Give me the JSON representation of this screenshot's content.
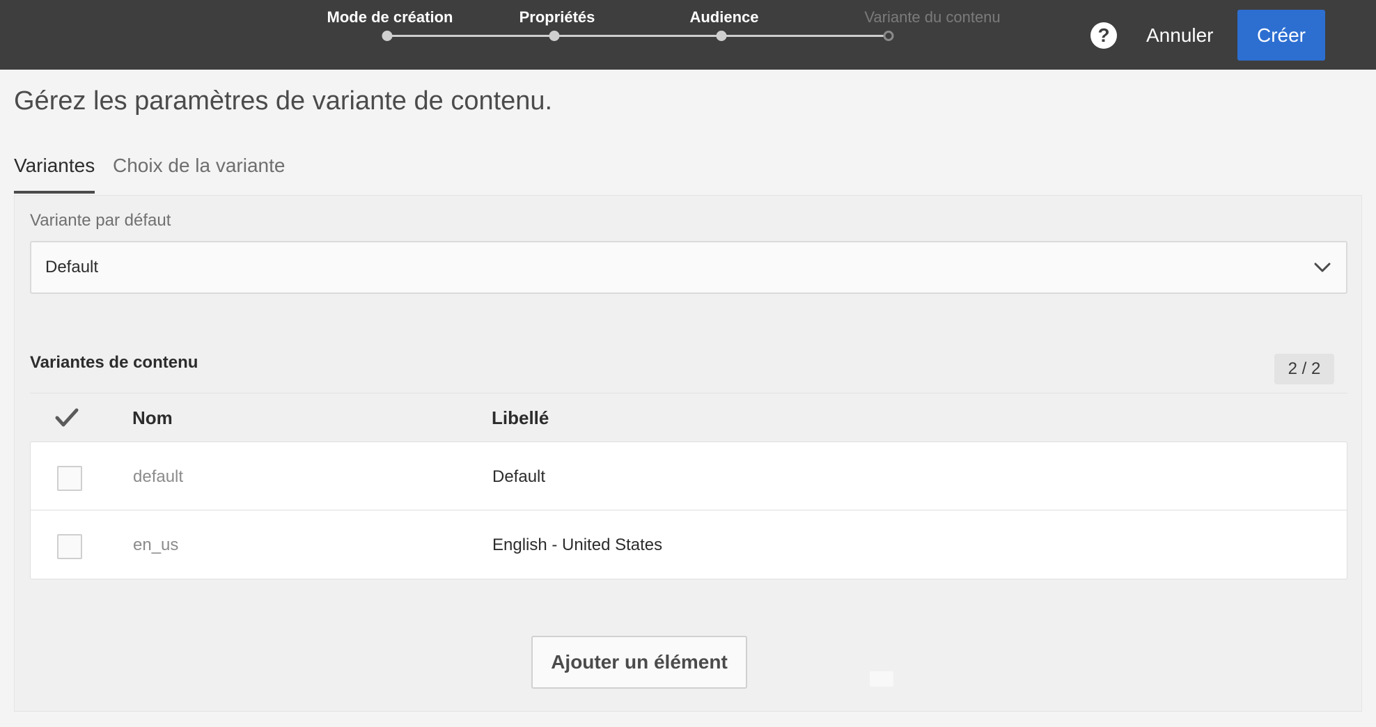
{
  "header": {
    "steps": [
      {
        "label": "Mode de création",
        "state": "done"
      },
      {
        "label": "Propriétés",
        "state": "done"
      },
      {
        "label": "Audience",
        "state": "done"
      },
      {
        "label": "Variante du contenu",
        "state": "current"
      }
    ],
    "help_symbol": "?",
    "cancel_label": "Annuler",
    "create_label": "Créer"
  },
  "page": {
    "title": "Gérez les paramètres de variante de contenu."
  },
  "tabs": [
    {
      "label": "Variantes",
      "active": true
    },
    {
      "label": "Choix de la variante",
      "active": false
    }
  ],
  "default_variant": {
    "label": "Variante par défaut",
    "value": "Default"
  },
  "variants": {
    "title": "Variantes de contenu",
    "count": "2 / 2",
    "columns": {
      "name": "Nom",
      "label": "Libellé"
    },
    "rows": [
      {
        "name": "default",
        "label": "Default"
      },
      {
        "name": "en_us",
        "label": "English - United States"
      }
    ],
    "add_label": "Ajouter un élément"
  },
  "colors": {
    "topbar": "#3e3e3e",
    "primary": "#2d6fd1",
    "background": "#f4f4f4"
  },
  "icons": {
    "help": "help-icon",
    "chevron": "chevron-down-icon",
    "select_all": "checkmark-icon"
  }
}
